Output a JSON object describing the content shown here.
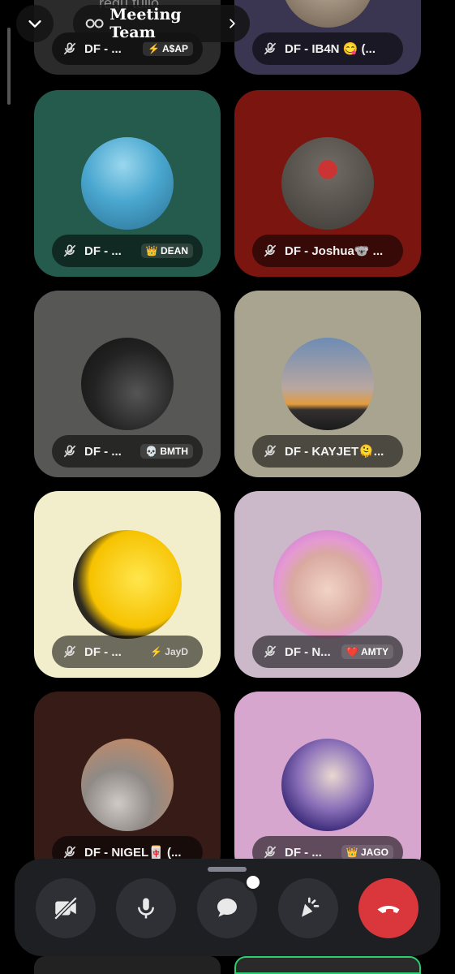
{
  "header": {
    "title": "Meeting Team",
    "overlay_text": "regu tulio"
  },
  "participants": [
    {
      "name": "DF - ...",
      "tag": "⚡ A$AP"
    },
    {
      "name": "DF - IB4N 😋 (...",
      "tag": ""
    },
    {
      "name": "DF - ...",
      "tag": "👑 DEAN"
    },
    {
      "name": "DF - Joshua🐨 ...",
      "tag": ""
    },
    {
      "name": "DF - ...",
      "tag": "💀 BMTH"
    },
    {
      "name": "DF - KAYJET🫠...",
      "tag": ""
    },
    {
      "name": "DF - ...",
      "tag": "⚡ JayD"
    },
    {
      "name": "DF - N...",
      "tag": "❤️ AMTY"
    },
    {
      "name": "DF - NIGEL🀄 (...",
      "tag": ""
    },
    {
      "name": "DF - ...",
      "tag": "👑 JAGO"
    }
  ],
  "controls": {
    "camera": "camera-off",
    "mic": "microphone",
    "chat": "chat",
    "activities": "activities",
    "end": "end-call"
  }
}
